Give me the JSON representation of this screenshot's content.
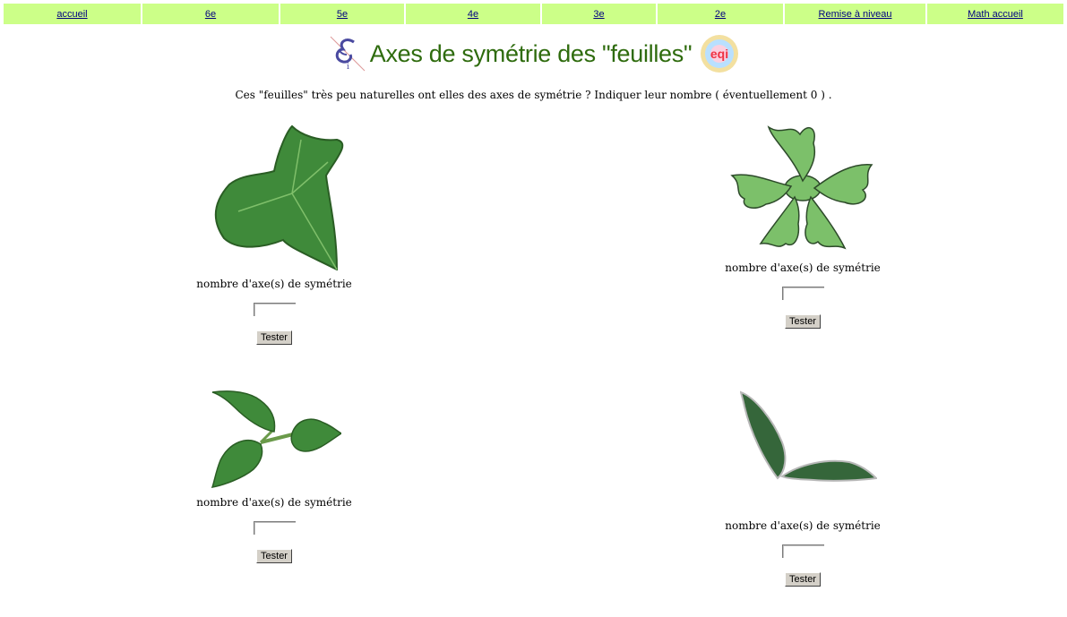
{
  "nav": {
    "items": [
      "accueil",
      "6e",
      "5e",
      "4e",
      "3e",
      "2e",
      "Remise à niveau",
      "Math accueil"
    ]
  },
  "header": {
    "title": "Axes de symétrie des \"feuilles\""
  },
  "instructions": "Ces \"feuilles\" très peu naturelles ont elles des axes de symétrie ? Indiquer leur nombre ( éventuellement 0 ) .",
  "leaves": [
    {
      "caption": "nombre d'axe(s) de symétrie",
      "input_value": "",
      "button": "Tester"
    },
    {
      "caption": "nombre d'axe(s) de symétrie",
      "input_value": "",
      "button": "Tester"
    },
    {
      "caption": "nombre d'axe(s) de symétrie",
      "input_value": "",
      "button": "Tester"
    },
    {
      "caption": "nombre d'axe(s) de symétrie",
      "input_value": "",
      "button": "Tester"
    }
  ],
  "colors": {
    "nav_bg": "#ccff88",
    "title": "#2e6b0d",
    "leaf_green": "#4a8a3a"
  },
  "icons": [
    "euclid-logo-icon",
    "eqi-logo-icon"
  ]
}
